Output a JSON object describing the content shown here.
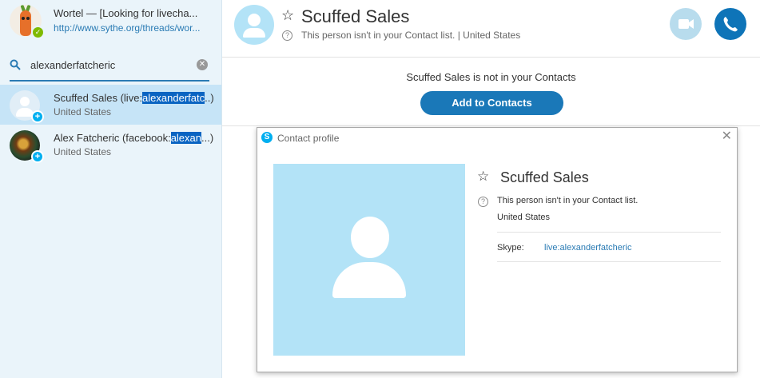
{
  "me": {
    "name": "Wortel — [Looking for livecha...",
    "mood": "http://www.sythe.org/threads/wor..."
  },
  "search": {
    "query": "alexanderfatcheric"
  },
  "results": [
    {
      "name_prefix": "Scuffed Sales (live:",
      "name_highlight": "alexanderfatc",
      "name_suffix": "..)",
      "location": "United States"
    },
    {
      "name_prefix": "Alex Fatcheric (facebook:",
      "name_highlight": "alexan",
      "name_suffix": "...)",
      "location": "United States"
    }
  ],
  "conversation": {
    "contact_name": "Scuffed Sales",
    "status_line": "This person isn't in your Contact list.  |  United States",
    "notice": "Scuffed Sales is not in your Contacts",
    "add_button": "Add to Contacts"
  },
  "profile_dialog": {
    "title": "Contact profile",
    "name": "Scuffed Sales",
    "status": "This person isn't in your Contact list.",
    "location": "United States",
    "skype_label": "Skype:",
    "skype_value": "live:alexanderfatcheric"
  },
  "colors": {
    "accent": "#0e74b8",
    "sidebar_bg": "#eaf4fa",
    "selected_row": "#c6e4f7",
    "avatar_placeholder": "#b3e3f7",
    "highlight": "#0a64c2"
  },
  "icons": [
    "star-icon",
    "question-icon",
    "video-icon",
    "phone-icon",
    "search-icon",
    "clear-icon",
    "close-icon",
    "skype-logo-icon",
    "add-contact-badge-icon",
    "online-status-icon"
  ]
}
